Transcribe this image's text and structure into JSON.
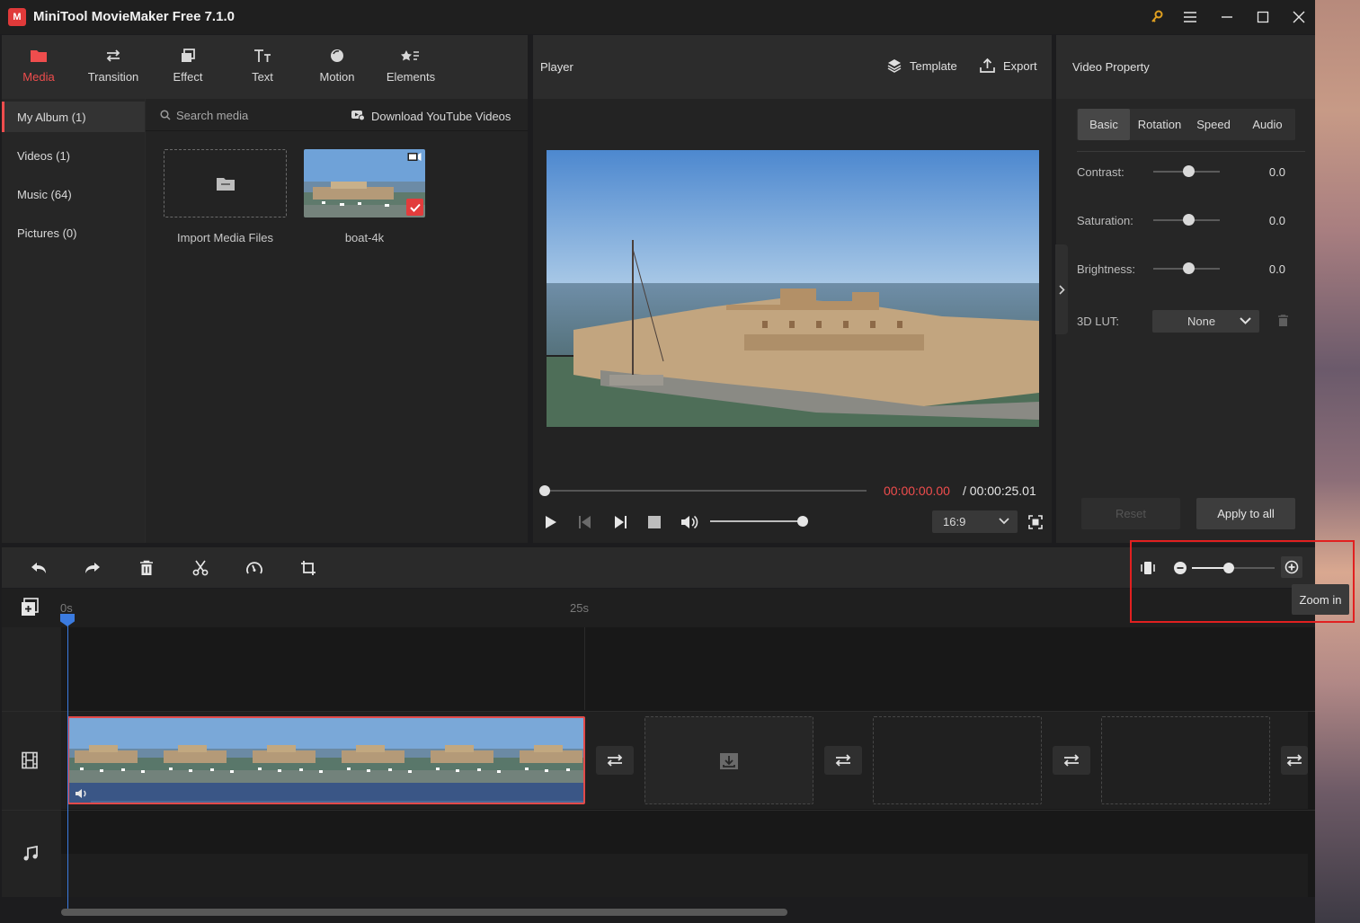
{
  "window": {
    "title": "MiniTool MovieMaker Free 7.1.0",
    "logo_text": "M"
  },
  "media_toolbar": {
    "tabs": [
      {
        "label": "Media",
        "icon": "folder-icon",
        "active": true
      },
      {
        "label": "Transition",
        "icon": "swap-arrows-icon"
      },
      {
        "label": "Effect",
        "icon": "effect-layers-icon"
      },
      {
        "label": "Text",
        "icon": "text-icon"
      },
      {
        "label": "Motion",
        "icon": "motion-ball-icon"
      },
      {
        "label": "Elements",
        "icon": "elements-icon"
      }
    ]
  },
  "media_sidebar": {
    "items": [
      {
        "label": "My Album (1)",
        "active": true
      },
      {
        "label": "Videos (1)"
      },
      {
        "label": "Music (64)"
      },
      {
        "label": "Pictures (0)"
      }
    ]
  },
  "media": {
    "search_placeholder": "Search media",
    "download_label": "Download YouTube Videos",
    "import_label": "Import Media Files",
    "items": [
      {
        "name": "boat-4k",
        "selected": true
      }
    ]
  },
  "player": {
    "title": "Player",
    "template_label": "Template",
    "export_label": "Export",
    "current_time": "00:00:00.00",
    "total_time": "/ 00:00:25.01",
    "aspect_ratio": "16:9"
  },
  "property": {
    "title": "Video Property",
    "tabs": [
      "Basic",
      "Rotation",
      "Speed",
      "Audio"
    ],
    "active_tab": "Basic",
    "rows": [
      {
        "label": "Contrast:",
        "value": "0.0"
      },
      {
        "label": "Saturation:",
        "value": "0.0"
      },
      {
        "label": "Brightness:",
        "value": "0.0"
      }
    ],
    "lut_label": "3D LUT:",
    "lut_value": "None",
    "reset_label": "Reset",
    "apply_label": "Apply to all"
  },
  "timeline": {
    "ruler": [
      "0s",
      "25s"
    ],
    "tooltip": "Zoom in"
  },
  "colors": {
    "accent": "#ef4d4d",
    "playhead": "#3b7be0",
    "highlight": "#e12020"
  }
}
